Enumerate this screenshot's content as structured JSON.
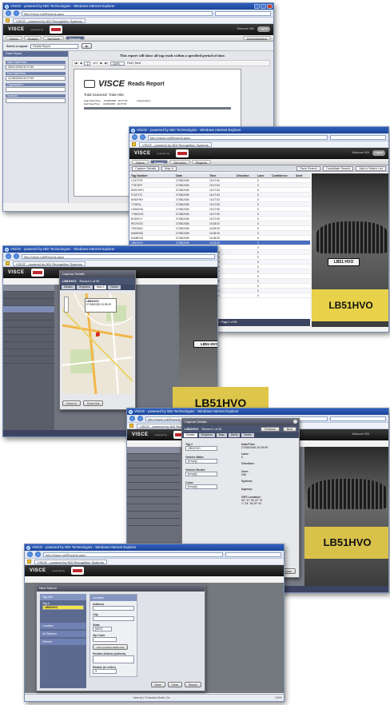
{
  "browser": {
    "title": "VISCE - powered by NDI Technologies - Windows Internet Explorer",
    "url": "http://visce.ndi/Reports.aspx",
    "tab": "VISCE - powered by NDI Recognition Systems",
    "zoom": "100%"
  },
  "app": {
    "brand": "VISCE",
    "powered": "powered by",
    "logo": "ndrs",
    "welcome": "Welcome NDI",
    "logout": "Logout",
    "menu": [
      "Home",
      "Search",
      "Services",
      "Reports"
    ],
    "admin": "Administration"
  },
  "screen1": {
    "select_label": "Select a Layout",
    "select_value": "Reads Report",
    "notice": "This report will show all tag reads within a specified period of time.",
    "page_box": "1",
    "page_of": "of 1",
    "zoom_select": "100%",
    "find": "Find | Next",
    "params_header": "Data Report",
    "param1_label": "Start Date/Time",
    "param1_value": "06/01/2008 00:07:50",
    "param2_label": "End Date/Time",
    "param2_value": "31/08/2008 00:07:50",
    "param3_label": "Organization",
    "param4_label": "Scanner",
    "report_title": "VISCE",
    "report_subtitle": "Reads Report",
    "total_label": "Total Scanned:",
    "total_value": "Total Hits:",
    "r1": "Start Date/Time",
    "r1v": "21/08/2008 - 00:07:50",
    "r2": "End Date/Time",
    "r2v": "31/08/2008 - 00:07:50",
    "r3": "Organization"
  },
  "screen2": {
    "title": "VISCE - powered by NDI Technologies - Windows Internet Explorer",
    "subnav": [
      "Capture Details",
      "Map It"
    ],
    "buttons": [
      "Save Search",
      "Candidate Search",
      "Add to Watch List"
    ],
    "columns": [
      "Tag Number",
      "Date",
      "Time",
      "Direction",
      "Lane",
      "Confidence",
      "Alert"
    ],
    "rows": [
      [
        "LC57OTE",
        "27/08/2008",
        "15:27:50",
        "",
        "0"
      ],
      [
        "YT57HFF",
        "27/08/2008",
        "15:27:53",
        "",
        "0"
      ],
      [
        "WV57HFH",
        "27/08/2008",
        "15:27:53",
        "",
        "0"
      ],
      [
        "FL57OTC",
        "27/08/2008",
        "15:27:53",
        "",
        "0"
      ],
      [
        "NH57HNY",
        "27/08/2008",
        "15:27:53",
        "",
        "0"
      ],
      [
        "Y736FLL",
        "27/08/2008",
        "15:27:59",
        "",
        "0"
      ],
      [
        "LD55OHU",
        "27/08/2008",
        "15:27:59",
        "",
        "0"
      ],
      [
        "YT56OHG",
        "27/08/2008",
        "15:27:59",
        "",
        "0"
      ],
      [
        "BO57KLY",
        "27/08/2008",
        "15:27:59",
        "",
        "0"
      ],
      [
        "RK07VOC",
        "27/08/2008",
        "15:28:03",
        "",
        "0"
      ],
      [
        "YR57AKK",
        "27/08/2008",
        "15:28:05",
        "",
        "0"
      ],
      [
        "EA08HSD",
        "27/08/2008",
        "15:28:05",
        "",
        "0"
      ],
      [
        "DA08EGS",
        "27/08/2008",
        "15:28:05",
        "",
        "0"
      ],
      [
        "LB51HVO",
        "27/08/2008",
        "15:28:09",
        "",
        "0"
      ],
      [
        "LB08EVF",
        "27/08/2008",
        "15:28:12",
        "",
        "0"
      ],
      [
        "YT57LLV",
        "27/08/2008",
        "15:28:14",
        "",
        "0"
      ],
      [
        "FL08YTT",
        "27/08/2008",
        "15:28:22",
        "",
        "0"
      ],
      [
        "YT08GOV",
        "27/08/2008",
        "15:28:24",
        "",
        "0"
      ],
      [
        "LR08EKV",
        "27/08/2008",
        "15:28:26",
        "",
        "0"
      ],
      [
        "LK57BPF",
        "27/08/2008",
        "15:28:27",
        "",
        "0"
      ],
      [
        "KL08GNT",
        "27/08/2008",
        "15:28:27",
        "",
        "0"
      ],
      [
        "KA08RNX",
        "27/08/2008",
        "15:28:29",
        "",
        "0"
      ],
      [
        "LB57GAV",
        "27/08/2008",
        "15:28:32",
        "",
        "0"
      ],
      [
        "LR08EKU",
        "27/08/2008",
        "15:28:33",
        "",
        "0"
      ],
      [
        "EY57KPL",
        "27/08/2008",
        "15:28:34",
        "",
        "0"
      ]
    ],
    "pager": "2464 Results / Page 1 of 50",
    "plate": "LB51HVO",
    "plate_small": "LB51 HVO",
    "status": "Internet | Protected Mode: On",
    "zoom": "100%"
  },
  "screen3": {
    "title": "VISCE - powered by NDI Technologies - Windows Internet Explorer",
    "dialog_title": "Capture Details",
    "tag": "LB51HVO",
    "record": "Record 1 of 50",
    "tabs": [
      "Details",
      "Graphics",
      "Map It",
      "Notes"
    ],
    "map_label": "LB51HVO",
    "map_date": "27/08/2008 15:28:09",
    "zoom_label": "Zoom In",
    "zoom_out": "Zoom Out",
    "plate": "LB51HVO",
    "pager": "50 Results / Page 1 of 1"
  },
  "screen4": {
    "title": "VISCE - powered by NDI Technologies - Windows Internet Explorer",
    "dialog_title": "Capture Details",
    "tag": "LB51HVO",
    "record": "Record 1 of 50",
    "tabs": [
      "Details",
      "Graphics",
      "Map",
      "Alerts",
      "Notes"
    ],
    "tag_label": "Tag #",
    "tag_value": "LB51HVO",
    "date_label": "Date/Time",
    "date_value": "27/08/2008 15:28:09",
    "make_label": "Vehicle Make:",
    "make_value": "[empty]",
    "model_label": "Vehicle Model:",
    "model_value": "[empty]",
    "color_label": "Color:",
    "color_value": "[empty]",
    "lane_label": "Lane:",
    "lane_value": "0",
    "direction_label": "Direction:",
    "user_label": "User:",
    "user_value": "NDI",
    "system_label": "System:",
    "agency_label": "Agency:",
    "gps_label": "GPS Location:",
    "gps1": "53° 47' 50.47\" N",
    "gps2": "1° 34' 18.25\" W",
    "nav_prev": "Previous",
    "nav_next": "Next",
    "close": "Close",
    "plate": "LB51HVO",
    "pager": "50 Results / Page 1 of 50"
  },
  "screen5": {
    "title": "VISCE - powered by NDI Technologies - Windows Internet Explorer",
    "dialog_title": "New Search",
    "left_items": [
      "Tag Info",
      "Tag #",
      "Location",
      "All Stations",
      "Filtered"
    ],
    "tag_value": "LB51HVO",
    "right_header": "Location",
    "address_label": "Address",
    "city_label": "City",
    "state_label": "State",
    "state_value": "[ANY]",
    "zip_label": "Zip Code",
    "within_label": "Find Locations Within this",
    "position_label": "Position Address (address)",
    "radius_label": "Radius (in miles)",
    "radius_value": "3",
    "clear": "Clear",
    "save": "Save",
    "search": "Search",
    "status": "Internet | Protected Mode: On",
    "zoom": "100%"
  }
}
